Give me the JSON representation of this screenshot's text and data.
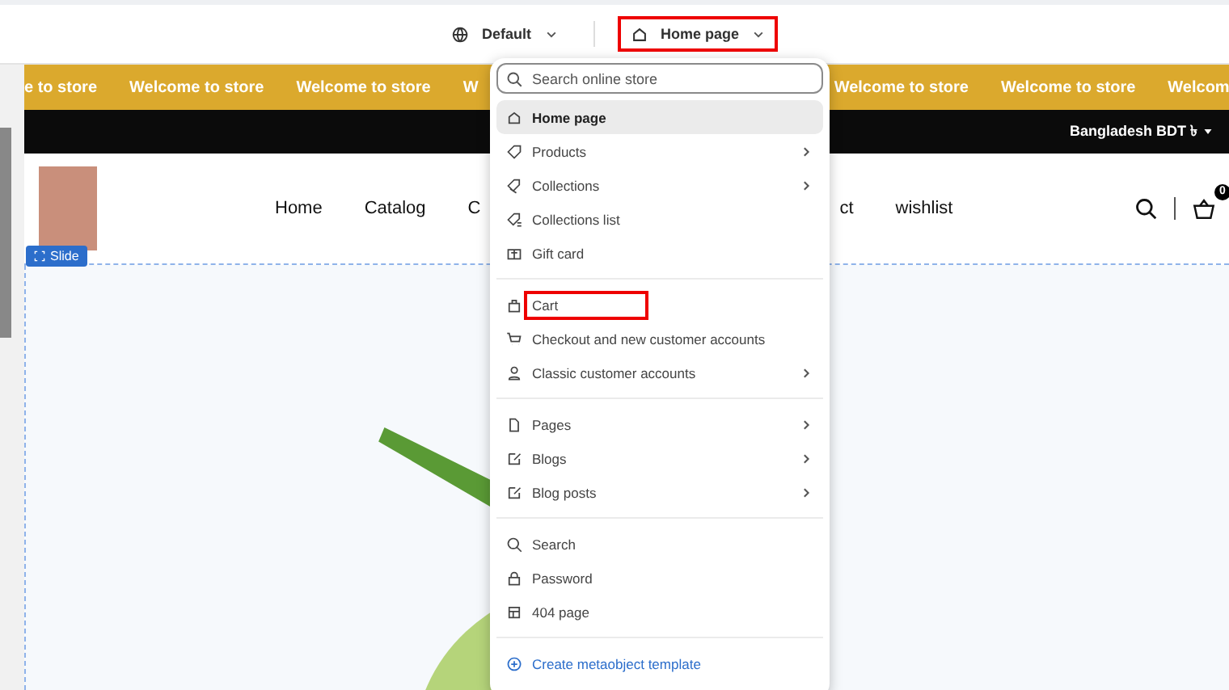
{
  "toolbar": {
    "theme": {
      "label": "Default"
    },
    "template": {
      "label": "Home page",
      "highlighted": true
    }
  },
  "announcement": {
    "items_left": [
      "e to store",
      "Welcome to store",
      "Welcome to store",
      "W"
    ],
    "items_right": [
      "Welcome to store",
      "Welcome to store",
      "Welcom"
    ]
  },
  "currency": {
    "label": "Bangladesh BDT ৳"
  },
  "nav": {
    "left": [
      "Home",
      "Catalog",
      "C"
    ],
    "right": [
      "ct",
      "wishlist"
    ]
  },
  "cart": {
    "count": "0"
  },
  "section_tag": {
    "label": "Slide"
  },
  "dropdown": {
    "search": {
      "placeholder": "Search online store"
    },
    "groups": [
      [
        {
          "label": "Home page",
          "selected": true,
          "has_submenu": false,
          "highlighted": false,
          "kind": "page"
        },
        {
          "label": "Products",
          "selected": false,
          "has_submenu": true,
          "highlighted": false,
          "kind": "page"
        },
        {
          "label": "Collections",
          "selected": false,
          "has_submenu": true,
          "highlighted": false,
          "kind": "page"
        },
        {
          "label": "Collections list",
          "selected": false,
          "has_submenu": false,
          "highlighted": false,
          "kind": "page"
        },
        {
          "label": "Gift card",
          "selected": false,
          "has_submenu": false,
          "highlighted": false,
          "kind": "page"
        }
      ],
      [
        {
          "label": "Cart",
          "selected": false,
          "has_submenu": false,
          "highlighted": true,
          "kind": "page"
        },
        {
          "label": "Checkout and new customer accounts",
          "selected": false,
          "has_submenu": false,
          "highlighted": false,
          "kind": "page"
        },
        {
          "label": "Classic customer accounts",
          "selected": false,
          "has_submenu": true,
          "highlighted": false,
          "kind": "page"
        }
      ],
      [
        {
          "label": "Pages",
          "selected": false,
          "has_submenu": true,
          "highlighted": false,
          "kind": "page"
        },
        {
          "label": "Blogs",
          "selected": false,
          "has_submenu": true,
          "highlighted": false,
          "kind": "page"
        },
        {
          "label": "Blog posts",
          "selected": false,
          "has_submenu": true,
          "highlighted": false,
          "kind": "page"
        }
      ],
      [
        {
          "label": "Search",
          "selected": false,
          "has_submenu": false,
          "highlighted": false,
          "kind": "page"
        },
        {
          "label": "Password",
          "selected": false,
          "has_submenu": false,
          "highlighted": false,
          "kind": "page"
        },
        {
          "label": "404 page",
          "selected": false,
          "has_submenu": false,
          "highlighted": false,
          "kind": "page"
        }
      ],
      [
        {
          "label": "Create metaobject template",
          "selected": false,
          "has_submenu": false,
          "highlighted": false,
          "kind": "action"
        }
      ]
    ]
  }
}
